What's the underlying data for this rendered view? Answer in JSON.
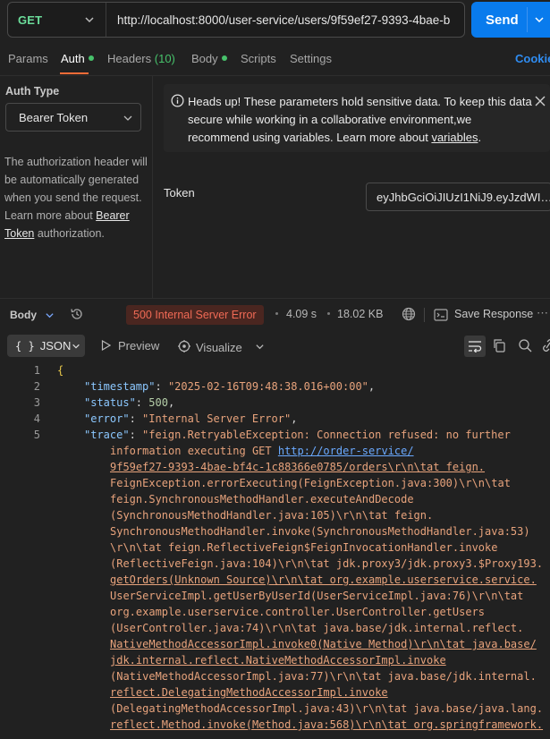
{
  "request": {
    "method": "GET",
    "url": "http://localhost:8000/user-service/users/9f59ef27-9393-4bae-b",
    "send_label": "Send"
  },
  "tabs": {
    "params": "Params",
    "auth": "Auth",
    "headers": "Headers",
    "headers_count": "(10)",
    "body": "Body",
    "scripts": "Scripts",
    "settings": "Settings",
    "cookies": "Cookie"
  },
  "auth": {
    "type_title": "Auth Type",
    "type_value": "Bearer Token",
    "description_1": "The authorization header will be automatically generated when you send the request. Learn more about ",
    "description_link": "Bearer Token",
    "description_2": " authorization.",
    "alert_text": "Heads up! These parameters hold sensitive data. To keep this data secure while working in a collaborative environment,we recommend using variables. Learn more about ",
    "alert_link": "variables",
    "alert_end": ".",
    "token_label": "Token",
    "token_value": "eyJhbGciOiJIUzI1NiJ9.eyJzdWI…"
  },
  "response": {
    "body_label": "Body",
    "status": "500 Internal Server Error",
    "time": "4.09 s",
    "size": "18.02 KB",
    "save_label": "Save Response",
    "format": "JSON",
    "preview_label": "Preview",
    "visualize_label": "Visualize"
  },
  "code": {
    "line_numbers": [
      "1",
      "2",
      "3",
      "4",
      "5"
    ],
    "open_brace": "{",
    "timestamp_key": "\"timestamp\"",
    "timestamp_val": "\"2025-02-16T09:48:38.016+00:00\"",
    "status_key": "\"status\"",
    "status_val": "500",
    "error_key": "\"error\"",
    "error_val": "\"Internal Server Error\"",
    "trace_key": "\"trace\"",
    "trace_start": "\"feign.RetryableException: Connection refused: no further",
    "trace_lines": [
      "information executing GET ",
      "9f59ef27-9393-4bae-bf4c-1c88366e0785/orders\\r\\n\\tat feign.",
      "FeignException.errorExecuting(FeignException.java:300)\\r\\n\\tat",
      "feign.SynchronousMethodHandler.executeAndDecode",
      "(SynchronousMethodHandler.java:105)\\r\\n\\tat feign.",
      "SynchronousMethodHandler.invoke(SynchronousMethodHandler.java:53)",
      "\\r\\n\\tat feign.ReflectiveFeign$FeignInvocationHandler.invoke",
      "(ReflectiveFeign.java:104)\\r\\n\\tat jdk.proxy3/jdk.proxy3.$Proxy193.",
      "getOrders(Unknown Source)\\r\\n\\tat org.example.userservice.service.",
      "UserServiceImpl.getUserByUserId(UserServiceImpl.java:76)\\r\\n\\tat",
      "org.example.userservice.controller.UserController.getUsers",
      "(UserController.java:74)\\r\\n\\tat java.base/jdk.internal.reflect.",
      "NativeMethodAccessorImpl.invoke0(Native Method)\\r\\n\\tat java.base/",
      "jdk.internal.reflect.NativeMethodAccessorImpl.invoke",
      "(NativeMethodAccessorImpl.java:77)\\r\\n\\tat java.base/jdk.internal.",
      "reflect.DelegatingMethodAccessorImpl.invoke",
      "(DelegatingMethodAccessorImpl.java:43)\\r\\n\\tat java.base/java.lang.",
      "reflect.Method.invoke(Method.java:568)\\r\\n\\tat org.springframework."
    ],
    "trace_link": "http://order-service/"
  }
}
